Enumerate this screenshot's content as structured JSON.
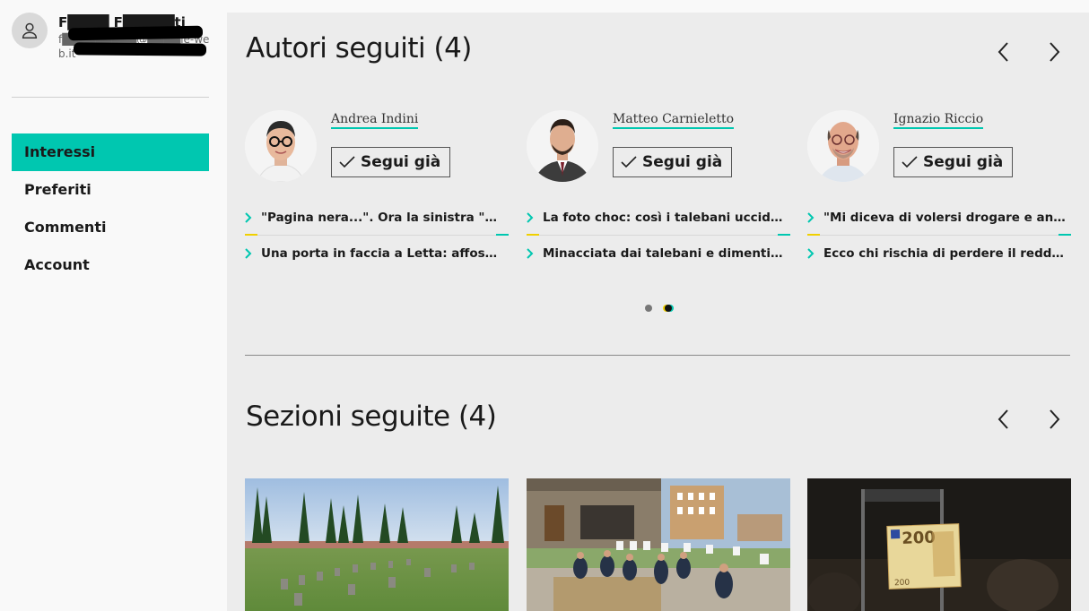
{
  "user": {
    "name": "F████ F█████ti",
    "email": "f█████████@████le-web.it"
  },
  "sidebar": {
    "items": [
      {
        "label": "Interessi",
        "active": true
      },
      {
        "label": "Preferiti",
        "active": false
      },
      {
        "label": "Commenti",
        "active": false
      },
      {
        "label": "Account",
        "active": false
      }
    ]
  },
  "authors": {
    "title": "Autori seguiti (4)",
    "cards": [
      {
        "name": "Andrea Indini",
        "button": "Segui già",
        "articles": [
          "\"Pagina nera...\". Ora la sinistra \"spara\" su Draghi",
          "Una porta in faccia a Letta: affossato il ddl Zan"
        ]
      },
      {
        "name": "Matteo Carnieletto",
        "button": "Segui già",
        "articles": [
          "La foto choc: così i talebani uccidono i civili",
          "Minacciata dai talebani e dimenticata da tutti"
        ]
      },
      {
        "name": "Ignazio Riccio",
        "button": "Segui già",
        "articles": [
          "\"Mi diceva di volersi drogare e andare via di casa\"",
          "Ecco chi rischia di perdere il reddito di cittadinanza"
        ]
      }
    ]
  },
  "sections": {
    "title": "Sezioni seguite (4)"
  },
  "colors": {
    "accent": "#00c7b0",
    "yellow": "#f0d000",
    "main_bg": "#ececec",
    "sidebar_bg": "#f9f9f9"
  }
}
